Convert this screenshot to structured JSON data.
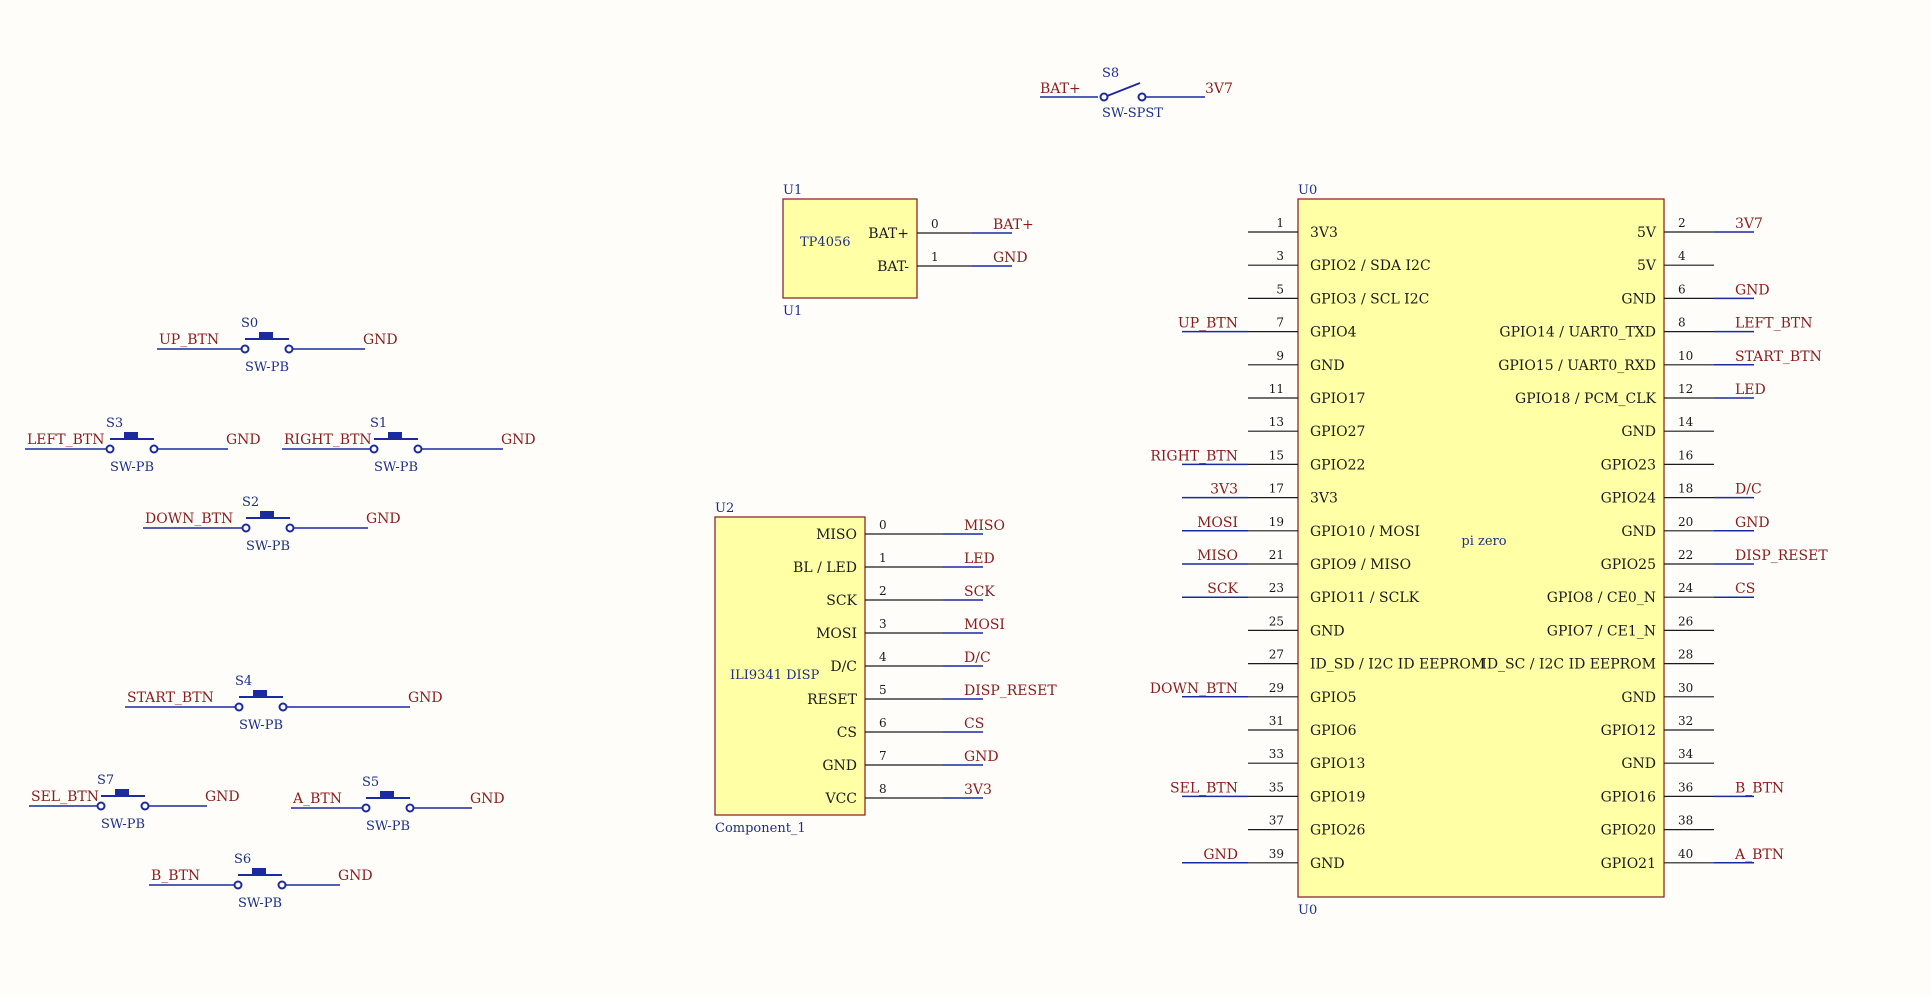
{
  "chips": [
    {
      "id": "u1",
      "designator": "U1",
      "designator_bottom": "U1",
      "title": "TP4056",
      "left_pins": [],
      "right_pins": [
        {
          "num": "0",
          "label": "BAT+",
          "net": "BAT+"
        },
        {
          "num": "1",
          "label": "BAT-",
          "net": "GND"
        }
      ]
    },
    {
      "id": "u2",
      "designator": "U2",
      "designator_bottom": "Component_1",
      "title": "ILI9341 DISP",
      "left_pins": [],
      "right_pins": [
        {
          "num": "0",
          "label": "MISO",
          "net": "MISO"
        },
        {
          "num": "1",
          "label": "BL / LED",
          "net": "LED"
        },
        {
          "num": "2",
          "label": "SCK",
          "net": "SCK"
        },
        {
          "num": "3",
          "label": "MOSI",
          "net": "MOSI"
        },
        {
          "num": "4",
          "label": "D/C",
          "net": "D/C"
        },
        {
          "num": "5",
          "label": "RESET",
          "net": "DISP_RESET"
        },
        {
          "num": "6",
          "label": "CS",
          "net": "CS"
        },
        {
          "num": "7",
          "label": "GND",
          "net": "GND"
        },
        {
          "num": "8",
          "label": "VCC",
          "net": "3V3"
        }
      ]
    },
    {
      "id": "u0",
      "designator": "U0",
      "designator_bottom": "U0",
      "title": "pi zero",
      "left_pins": [
        {
          "num": "1",
          "label": "3V3",
          "net": ""
        },
        {
          "num": "3",
          "label": "GPIO2 / SDA I2C",
          "net": ""
        },
        {
          "num": "5",
          "label": "GPIO3 / SCL I2C",
          "net": ""
        },
        {
          "num": "7",
          "label": "GPIO4",
          "net": "UP_BTN"
        },
        {
          "num": "9",
          "label": "GND",
          "net": ""
        },
        {
          "num": "11",
          "label": "GPIO17",
          "net": ""
        },
        {
          "num": "13",
          "label": "GPIO27",
          "net": ""
        },
        {
          "num": "15",
          "label": "GPIO22",
          "net": "RIGHT_BTN"
        },
        {
          "num": "17",
          "label": "3V3",
          "net": "3V3"
        },
        {
          "num": "19",
          "label": "GPIO10 / MOSI",
          "net": "MOSI"
        },
        {
          "num": "21",
          "label": "GPIO9 / MISO",
          "net": "MISO"
        },
        {
          "num": "23",
          "label": "GPIO11 / SCLK",
          "net": "SCK"
        },
        {
          "num": "25",
          "label": "GND",
          "net": ""
        },
        {
          "num": "27",
          "label": "ID_SD / I2C ID EEPROM",
          "net": ""
        },
        {
          "num": "29",
          "label": "GPIO5",
          "net": "DOWN_BTN"
        },
        {
          "num": "31",
          "label": "GPIO6",
          "net": ""
        },
        {
          "num": "33",
          "label": "GPIO13",
          "net": ""
        },
        {
          "num": "35",
          "label": "GPIO19",
          "net": "SEL_BTN"
        },
        {
          "num": "37",
          "label": "GPIO26",
          "net": ""
        },
        {
          "num": "39",
          "label": "GND",
          "net": "GND"
        }
      ],
      "right_pins": [
        {
          "num": "2",
          "label": "5V",
          "net": "3V7"
        },
        {
          "num": "4",
          "label": "5V",
          "net": ""
        },
        {
          "num": "6",
          "label": "GND",
          "net": "GND"
        },
        {
          "num": "8",
          "label": "GPIO14 / UART0_TXD",
          "net": "LEFT_BTN"
        },
        {
          "num": "10",
          "label": "GPIO15 / UART0_RXD",
          "net": "START_BTN"
        },
        {
          "num": "12",
          "label": "GPIO18 / PCM_CLK",
          "net": "LED"
        },
        {
          "num": "14",
          "label": "GND",
          "net": ""
        },
        {
          "num": "16",
          "label": "GPIO23",
          "net": ""
        },
        {
          "num": "18",
          "label": "GPIO24",
          "net": "D/C"
        },
        {
          "num": "20",
          "label": "GND",
          "net": "GND"
        },
        {
          "num": "22",
          "label": "GPIO25",
          "net": "DISP_RESET"
        },
        {
          "num": "24",
          "label": "GPIO8 / CE0_N",
          "net": "CS"
        },
        {
          "num": "26",
          "label": "GPIO7 / CE1_N",
          "net": ""
        },
        {
          "num": "28",
          "label": "ID_SC / I2C ID EEPROM",
          "net": ""
        },
        {
          "num": "30",
          "label": "GND",
          "net": ""
        },
        {
          "num": "32",
          "label": "GPIO12",
          "net": ""
        },
        {
          "num": "34",
          "label": "GND",
          "net": ""
        },
        {
          "num": "36",
          "label": "GPIO16",
          "net": "B_BTN"
        },
        {
          "num": "38",
          "label": "GPIO20",
          "net": ""
        },
        {
          "num": "40",
          "label": "GPIO21",
          "net": "A_BTN"
        }
      ]
    }
  ],
  "switches": [
    {
      "id": "s8",
      "designator": "S8",
      "value": "SW-SPST",
      "type": "spst",
      "net_left": "BAT+",
      "net_right": "3V7"
    },
    {
      "id": "s0",
      "designator": "S0",
      "value": "SW-PB",
      "type": "pb",
      "net_left": "UP_BTN",
      "net_right": "GND"
    },
    {
      "id": "s3",
      "designator": "S3",
      "value": "SW-PB",
      "type": "pb",
      "net_left": "LEFT_BTN",
      "net_right": "GND"
    },
    {
      "id": "s1",
      "designator": "S1",
      "value": "SW-PB",
      "type": "pb",
      "net_left": "RIGHT_BTN",
      "net_right": "GND"
    },
    {
      "id": "s2",
      "designator": "S2",
      "value": "SW-PB",
      "type": "pb",
      "net_left": "DOWN_BTN",
      "net_right": "GND"
    },
    {
      "id": "s4",
      "designator": "S4",
      "value": "SW-PB",
      "type": "pb",
      "net_left": "START_BTN",
      "net_right": "GND"
    },
    {
      "id": "s7",
      "designator": "S7",
      "value": "SW-PB",
      "type": "pb",
      "net_left": "SEL_BTN",
      "net_right": "GND"
    },
    {
      "id": "s5",
      "designator": "S5",
      "value": "SW-PB",
      "type": "pb",
      "net_left": "A_BTN",
      "net_right": "GND"
    },
    {
      "id": "s6",
      "designator": "S6",
      "value": "SW-PB",
      "type": "pb",
      "net_left": "B_BTN",
      "net_right": "GND"
    }
  ],
  "colors": {
    "background": "#fffdfa",
    "part_fill": "#ffffa6",
    "part_border": "#8b2a2a",
    "wire": "#1c2aa0",
    "net_label": "#8a1c1c",
    "designator": "#1b2f86"
  }
}
